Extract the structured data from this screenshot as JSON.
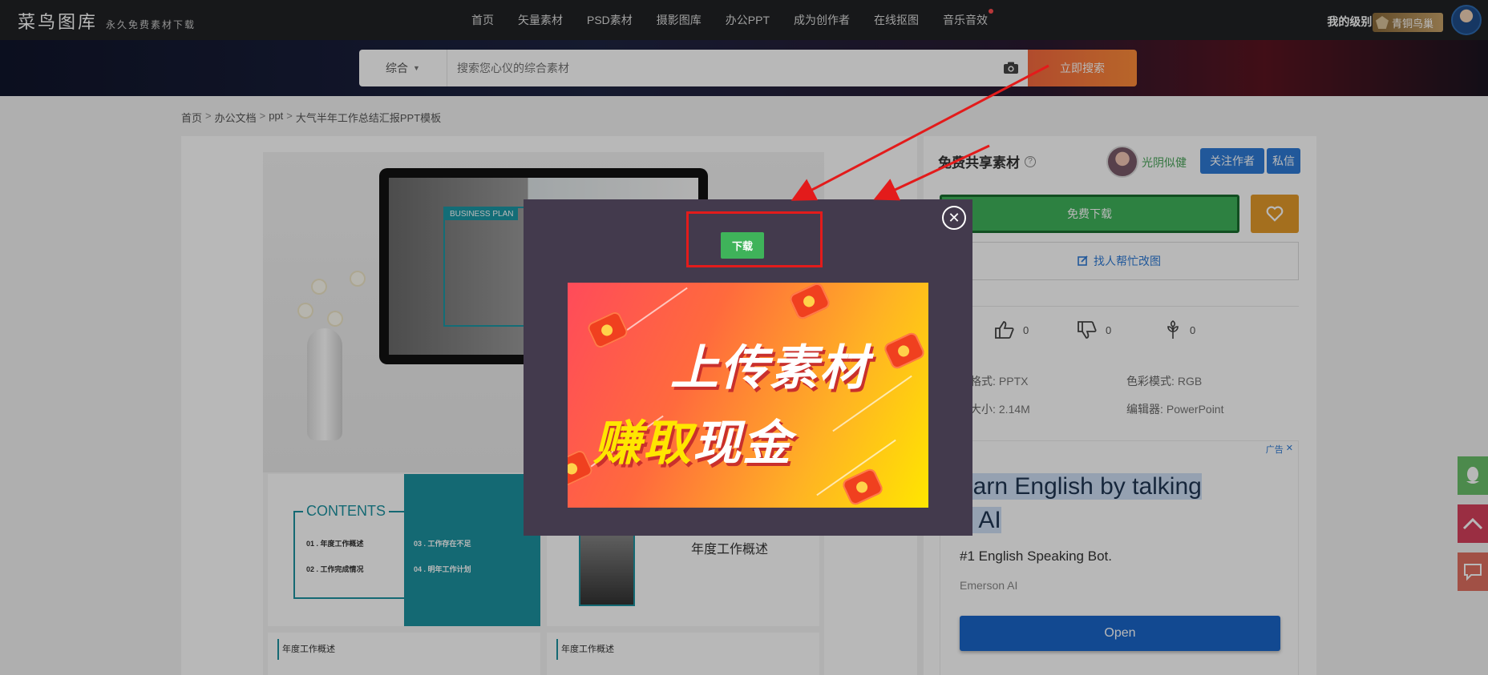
{
  "logo": {
    "main": "菜鸟图库",
    "sub": "永久免费素材下载"
  },
  "nav": [
    {
      "label": "首页"
    },
    {
      "label": "矢量素材"
    },
    {
      "label": "PSD素材"
    },
    {
      "label": "摄影图库"
    },
    {
      "label": "办公PPT"
    },
    {
      "label": "成为创作者"
    },
    {
      "label": "在线抠图"
    },
    {
      "label": "音乐音效"
    }
  ],
  "user": {
    "level_label": "我的级别:",
    "level_name": "青铜鸟巢"
  },
  "search": {
    "category": "综合",
    "placeholder": "搜索您心仪的综合素材",
    "button": "立即搜索"
  },
  "breadcrumb": [
    "首页",
    "办公文档",
    "ppt",
    "大气半年工作总结汇报PPT模板"
  ],
  "preview": {
    "business_plan": "BUSINESS PLAN",
    "contents_title": "CONTENTS",
    "contents_items": [
      "01 . 年度工作概述",
      "02 . 工作完成情况",
      "03 . 工作存在不足",
      "04 . 明年工作计划"
    ],
    "annual_title": "年度工作概述",
    "small_slide_title": "年度工作概述"
  },
  "sidebar": {
    "title": "免费共享素材",
    "author_name": "光阴似健",
    "follow": "关注作者",
    "message": "私信",
    "download": "免费下载",
    "help": "找人帮忙改图",
    "stats": {
      "likes": "0",
      "dislikes": "0",
      "collects": "0"
    },
    "info": {
      "format_label": "品格式:",
      "format": "PPTX",
      "color_label": "色彩模式:",
      "color": "RGB",
      "size_label": "品大小:",
      "size": "2.14M",
      "editor_label": "编辑器:",
      "editor": "PowerPoint"
    }
  },
  "ad": {
    "tag": "广告",
    "title_a": "earn English by talking",
    "title_b": "o AI",
    "subtitle": "#1 English Speaking Bot.",
    "brand": "Emerson AI",
    "button": "Open"
  },
  "modal": {
    "download": "下载",
    "promo_line1": "上传素材",
    "promo_line2_hl": "赚取",
    "promo_line2_rest": "现金"
  },
  "colors": {
    "nav_bg": "#202225",
    "search_btn": "#f6693f",
    "download_green": "#3fb35a",
    "follow_blue": "#2f7bd6",
    "favorite_orange": "#e39a2a",
    "annotation_red": "#e31b1b",
    "modal_bg": "#433a4d"
  }
}
